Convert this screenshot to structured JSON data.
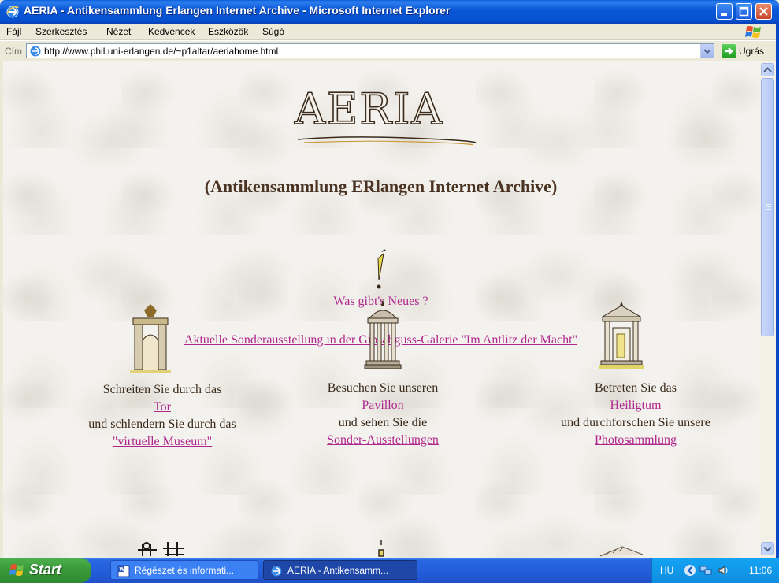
{
  "window": {
    "title": "AERIA - Antikensammlung Erlangen Internet Archive - Microsoft Internet Explorer"
  },
  "menu": [
    "Fájl",
    "Szerkesztés",
    "Nézet",
    "Kedvencek",
    "Eszközök",
    "Súgó"
  ],
  "address": {
    "label": "Cím",
    "url": "http://www.phil.uni-erlangen.de/~p1altar/aeriahome.html",
    "go_label": "Ugrás"
  },
  "page": {
    "logo_text": "AERIA",
    "subtitle": "(Antikensammlung ERlangen Internet Archive)",
    "news_link": "Was gibt's Neues ?",
    "exhibition_link": "Aktuelle Sonderausstellung in der Gipsabguss-Galerie \"Im Antlitz der Macht\"",
    "columns": [
      {
        "line1": "Schreiten Sie durch das",
        "link1": "Tor",
        "line2": "und schlendern Sie durch das",
        "link2": "\"virtuelle Museum\""
      },
      {
        "line1": "Besuchen Sie unseren",
        "link1": "Pavillon",
        "line2": "und sehen Sie die",
        "link2": "Sonder-Ausstellungen"
      },
      {
        "line1": "Betreten Sie das",
        "link1": "Heiligtum",
        "line2": "und durchforschen Sie unsere",
        "link2": "Photosammlung"
      }
    ]
  },
  "scroll": {
    "thumb_fraction_visible": 0.52
  },
  "taskbar": {
    "start_label": "Start",
    "tasks": [
      "Régészet és informati...",
      "AERIA - Antikensamm..."
    ],
    "lang": "HU",
    "clock": "11:06"
  },
  "colors": {
    "link": "#b0268c",
    "text": "#3a2a1a"
  }
}
